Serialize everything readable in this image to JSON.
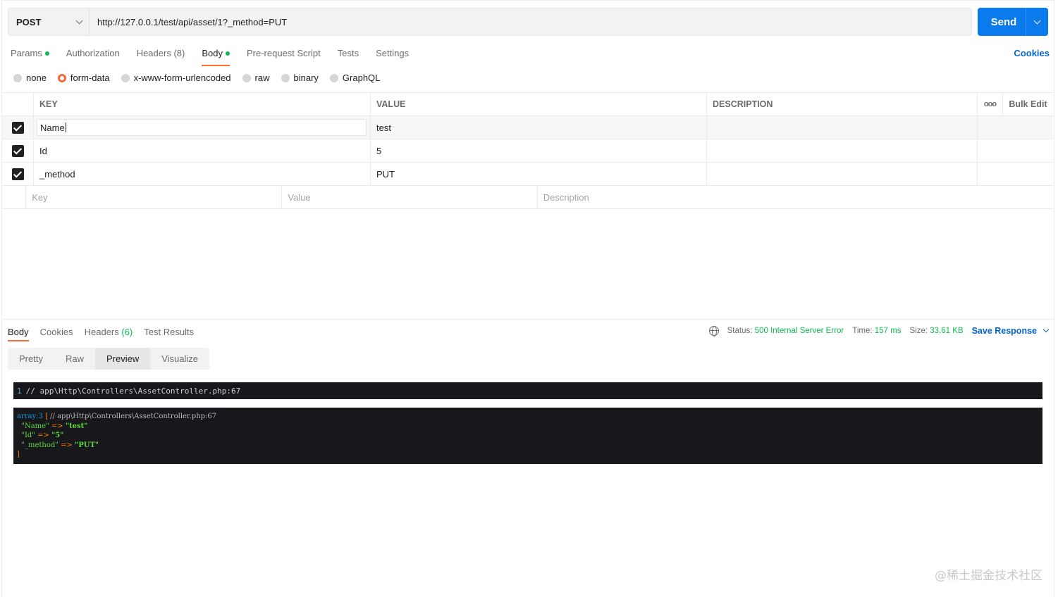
{
  "request": {
    "method": "POST",
    "url": "http://127.0.0.1/test/api/asset/1?_method=PUT",
    "send_label": "Send"
  },
  "req_tabs": [
    {
      "label": "Params",
      "dot": true
    },
    {
      "label": "Authorization"
    },
    {
      "label": "Headers",
      "count": "(8)"
    },
    {
      "label": "Body",
      "dot": true,
      "active": true
    },
    {
      "label": "Pre-request Script"
    },
    {
      "label": "Tests"
    },
    {
      "label": "Settings"
    }
  ],
  "cookies_label": "Cookies",
  "body_modes": [
    "none",
    "form-data",
    "x-www-form-urlencoded",
    "raw",
    "binary",
    "GraphQL"
  ],
  "body_mode_selected": "form-data",
  "table": {
    "headers": {
      "key": "KEY",
      "value": "VALUE",
      "description": "DESCRIPTION",
      "bulk_edit": "Bulk Edit"
    },
    "rows": [
      {
        "key": "Name",
        "value": "test",
        "description": ""
      },
      {
        "key": "Id",
        "value": "5",
        "description": ""
      },
      {
        "key": "_method",
        "value": "PUT",
        "description": ""
      }
    ],
    "placeholders": {
      "key": "Key",
      "value": "Value",
      "description": "Description"
    }
  },
  "response": {
    "tabs": [
      {
        "label": "Body",
        "active": true
      },
      {
        "label": "Cookies"
      },
      {
        "label": "Headers",
        "count": "(6)"
      },
      {
        "label": "Test Results"
      }
    ],
    "status_label": "Status:",
    "status_value": "500 Internal Server Error",
    "time_label": "Time:",
    "time_value": "157 ms",
    "size_label": "Size:",
    "size_value": "33.61 KB",
    "save_label": "Save Response",
    "views": [
      "Pretty",
      "Raw",
      "Preview",
      "Visualize"
    ],
    "view_selected": "Preview",
    "code_line_no": "1",
    "code_line": "// app\\Http\\Controllers\\AssetController.php:67",
    "dump": {
      "head": "array:3",
      "open": "[",
      "comment": "// app\\Http\\Controllers\\AssetController.php:67",
      "entries": [
        {
          "k": "\"Name\"",
          "v": "test"
        },
        {
          "k": "\"Id\"",
          "v": "5"
        },
        {
          "k": "\"_method\"",
          "v": "PUT"
        }
      ],
      "arrow": "=>",
      "close": "]"
    }
  },
  "watermark": "@稀土掘金技术社区",
  "colors": {
    "accent": "#ff6c37",
    "send": "#097bed",
    "link": "#0265d2",
    "success": "#0cbb52"
  }
}
